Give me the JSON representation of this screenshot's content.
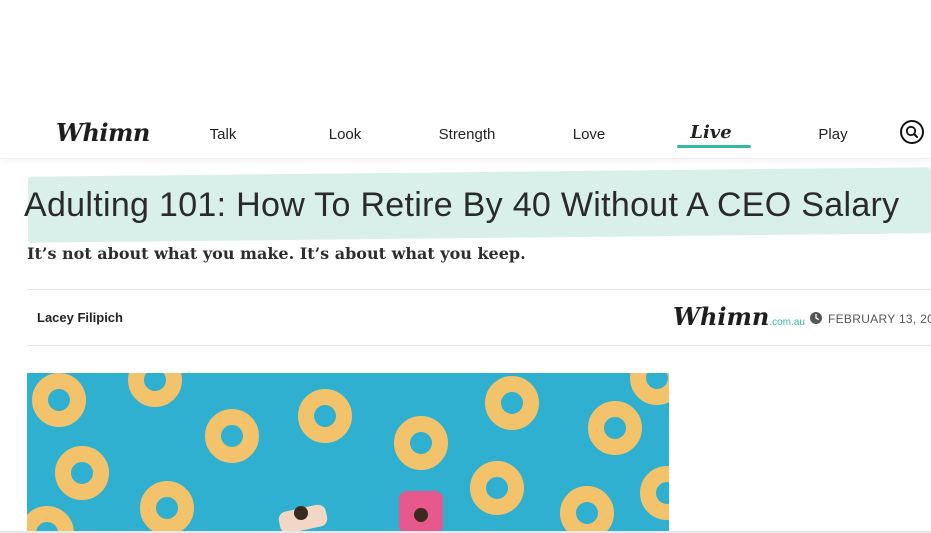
{
  "nav": {
    "logo": "Whimn",
    "items": [
      {
        "label": "Talk"
      },
      {
        "label": "Look"
      },
      {
        "label": "Strength"
      },
      {
        "label": "Love"
      },
      {
        "label": "Live"
      },
      {
        "label": "Play"
      }
    ],
    "active": "Live",
    "accent_color": "#35b9a6"
  },
  "article": {
    "title": "Adulting 101: How To Retire By 40 Without A CEO Salary",
    "subtitle": "It’s not about what you make. It’s about what you keep.",
    "author": "Lacey Filipich",
    "source_logo": "Whimn",
    "source_domain": ".com.au",
    "date": "FEBRUARY 13, 20",
    "highlight_color": "#d9f0ea",
    "hero_image": {
      "description_icon": "pool-floats-photo",
      "water_color": "#2fb0d0",
      "float_color": "#f5c46b"
    }
  }
}
